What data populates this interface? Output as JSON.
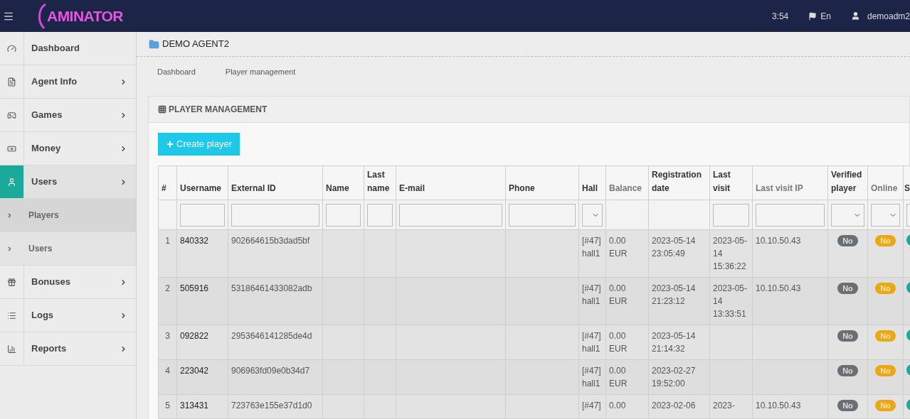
{
  "topbar": {
    "logo": "AMINATOR",
    "time": "3:54",
    "language": "En",
    "user": "demoadm2"
  },
  "sidebar": {
    "items": [
      {
        "label": "Dashboard",
        "selected": false,
        "has_children": false
      },
      {
        "label": "Agent Info",
        "selected": false,
        "has_children": true
      },
      {
        "label": "Games",
        "selected": false,
        "has_children": true
      },
      {
        "label": "Money",
        "selected": false,
        "has_children": true
      },
      {
        "label": "Users",
        "selected": true,
        "has_children": true,
        "children": [
          {
            "label": "Players",
            "selected": true
          },
          {
            "label": "Users",
            "selected": false
          }
        ]
      },
      {
        "label": "Bonuses",
        "selected": false,
        "has_children": true
      },
      {
        "label": "Logs",
        "selected": false,
        "has_children": true
      },
      {
        "label": "Reports",
        "selected": false,
        "has_children": true
      }
    ]
  },
  "page_title": "DEMO AGENT2",
  "breadcrumbs": [
    "Dashboard",
    "Player management"
  ],
  "panel": {
    "title": "PLAYER MANAGEMENT",
    "create_button": "Create player"
  },
  "table": {
    "columns": [
      {
        "label": "#",
        "kind": "plain",
        "muted": false
      },
      {
        "label": "Username",
        "kind": "text",
        "muted": false
      },
      {
        "label": "External ID",
        "kind": "text",
        "muted": false
      },
      {
        "label": "Name",
        "kind": "text",
        "muted": false
      },
      {
        "label": "Last name",
        "kind": "text",
        "muted": false
      },
      {
        "label": "E-mail",
        "kind": "text",
        "muted": false
      },
      {
        "label": "Phone",
        "kind": "text",
        "muted": false
      },
      {
        "label": "Hall",
        "kind": "select",
        "muted": false
      },
      {
        "label": "Balance",
        "kind": "plain",
        "muted": true
      },
      {
        "label": "Registration date",
        "kind": "plain",
        "muted": false
      },
      {
        "label": "Last visit",
        "kind": "text",
        "muted": false
      },
      {
        "label": "Last visit IP",
        "kind": "text",
        "muted": true
      },
      {
        "label": "Verified player",
        "kind": "select",
        "muted": false
      },
      {
        "label": "Online",
        "kind": "select",
        "muted": true
      },
      {
        "label": "S",
        "kind": "text",
        "muted": false
      }
    ],
    "rows": [
      {
        "n": "1",
        "username": "840332",
        "external_id": "902664615b3dad5bf",
        "hall": "[#47] hall1",
        "balance": "0.00 EUR",
        "registration": "2023-05-14 23:05:49",
        "last_visit": "2023-05-14 15:36:22",
        "ip": "10.10.50.43",
        "verified": "No",
        "online": "No"
      },
      {
        "n": "2",
        "username": "505916",
        "external_id": "53186461433082adb",
        "hall": "[#47] hall1",
        "balance": "0.00 EUR",
        "registration": "2023-05-14 21:23:12",
        "last_visit": "2023-05-14 13:33:51",
        "ip": "10.10.50.43",
        "verified": "No",
        "online": "No"
      },
      {
        "n": "3",
        "username": "092822",
        "external_id": "2953646141285de4d",
        "hall": "[#47] hall1",
        "balance": "0.00 EUR",
        "registration": "2023-05-14 21:14:32",
        "verified": "No",
        "online": "No"
      },
      {
        "n": "4",
        "username": "223042",
        "external_id": "906963fd09e0b34d7",
        "hall": "[#47] hall1",
        "balance": "0.00 EUR",
        "registration": "2023-02-27 19:52:00",
        "verified": "No",
        "online": "No"
      },
      {
        "n": "5",
        "username": "313431",
        "external_id": "723763e155e37d1d0",
        "hall": "[#47]",
        "balance": "0.00",
        "registration": "2023-02-06",
        "last_visit": "2023-",
        "ip": "10.10.50.43",
        "verified": "No",
        "online": "No"
      }
    ]
  }
}
